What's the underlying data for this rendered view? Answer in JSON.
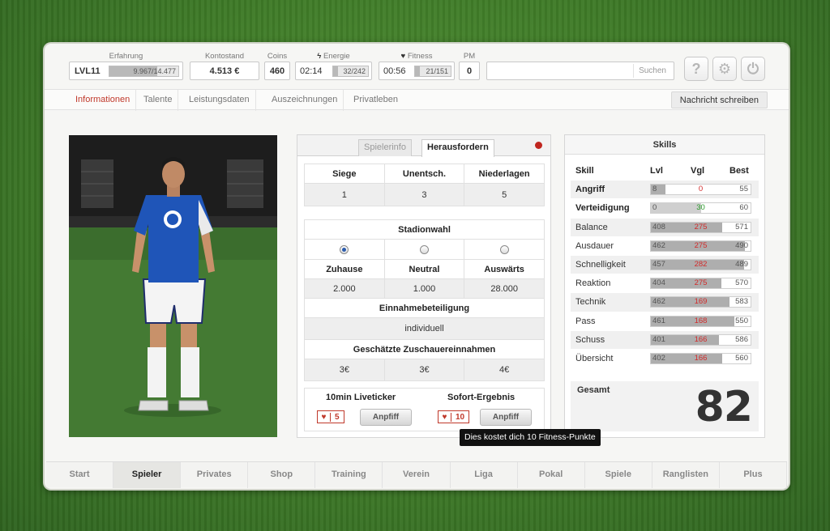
{
  "topbar": {
    "erfahrung_label": "Erfahrung",
    "level": "LVL11",
    "xp": "9.967/14.477",
    "xp_fraction": 0.69,
    "kontostand_label": "Kontostand",
    "kontostand": "4.513 €",
    "coins_label": "Coins",
    "coins": "460",
    "energie_label": "Energie",
    "energie_timer": "02:14",
    "energie_value": "32/242",
    "energie_fraction": 0.13,
    "fitness_label": "Fitness",
    "fitness_timer": "00:56",
    "fitness_value": "21/151",
    "fitness_fraction": 0.14,
    "pm_label": "PM",
    "pm": "0",
    "search_button": "Suchen",
    "help_icon": "?",
    "settings_icon": "⚙",
    "power_icon": "⏻"
  },
  "subnav": {
    "tabs": [
      "Informationen",
      "Talente",
      "Leistungsdaten",
      "Auszeichnungen",
      "Privatleben"
    ],
    "active": "Informationen",
    "message_button": "Nachricht schreiben"
  },
  "challenge": {
    "tabs": [
      "Spielerinfo",
      "Herausfordern"
    ],
    "active_tab": "Herausfordern",
    "record_headers": [
      "Siege",
      "Unentsch.",
      "Niederlagen"
    ],
    "record_values": [
      "1",
      "3",
      "5"
    ],
    "stadium_title": "Stadionwahl",
    "stadium_options": [
      "Zuhause",
      "Neutral",
      "Auswärts"
    ],
    "stadium_selected": "Zuhause",
    "capacity_values": [
      "2.000",
      "1.000",
      "28.000"
    ],
    "revenue_share_title": "Einnahmebeteiligung",
    "revenue_share_value": "individuell",
    "estimated_title": "Geschätzte Zuschauereinnahmen",
    "estimated_values": [
      "3€",
      "3€",
      "4€"
    ],
    "liveticker_label": "10min Liveticker",
    "liveticker_cost": "5",
    "instant_label": "Sofort-Ergebnis",
    "instant_cost": "10",
    "kickoff_label": "Anpfiff",
    "tooltip": "Dies kostet dich 10 Fitness-Punkte"
  },
  "skills": {
    "title": "Skills",
    "headers": [
      "Skill",
      "Lvl",
      "Vgl",
      "Best"
    ],
    "rows": [
      {
        "name": "Angriff",
        "lvl": "8",
        "vgl": "0",
        "best": "55",
        "bold": true,
        "vgl_color": "#d22a2a"
      },
      {
        "name": "Verteidigung",
        "lvl": "0",
        "vgl": "30",
        "best": "60",
        "bold": true,
        "vgl_color": "#2a9a2a"
      },
      {
        "name": "Balance",
        "lvl": "408",
        "vgl": "275",
        "best": "571",
        "vgl_color": "#d22a2a"
      },
      {
        "name": "Ausdauer",
        "lvl": "462",
        "vgl": "275",
        "best": "490",
        "vgl_color": "#d22a2a"
      },
      {
        "name": "Schnelligkeit",
        "lvl": "457",
        "vgl": "282",
        "best": "489",
        "vgl_color": "#d22a2a"
      },
      {
        "name": "Reaktion",
        "lvl": "404",
        "vgl": "275",
        "best": "570",
        "vgl_color": "#d22a2a"
      },
      {
        "name": "Technik",
        "lvl": "462",
        "vgl": "169",
        "best": "583",
        "vgl_color": "#d22a2a"
      },
      {
        "name": "Pass",
        "lvl": "461",
        "vgl": "168",
        "best": "550",
        "vgl_color": "#d22a2a"
      },
      {
        "name": "Schuss",
        "lvl": "401",
        "vgl": "166",
        "best": "586",
        "vgl_color": "#d22a2a"
      },
      {
        "name": "Übersicht",
        "lvl": "402",
        "vgl": "166",
        "best": "560",
        "vgl_color": "#d22a2a"
      }
    ],
    "total_label": "Gesamt",
    "total_value": "82"
  },
  "bottomnav": {
    "items": [
      "Start",
      "Spieler",
      "Privates",
      "Shop",
      "Training",
      "Verein",
      "Liga",
      "Pokal",
      "Spiele",
      "Ranglisten",
      "Plus"
    ],
    "active": "Spieler"
  },
  "colors": {
    "accent_red": "#c0392b",
    "jersey_blue": "#1f55b8"
  }
}
